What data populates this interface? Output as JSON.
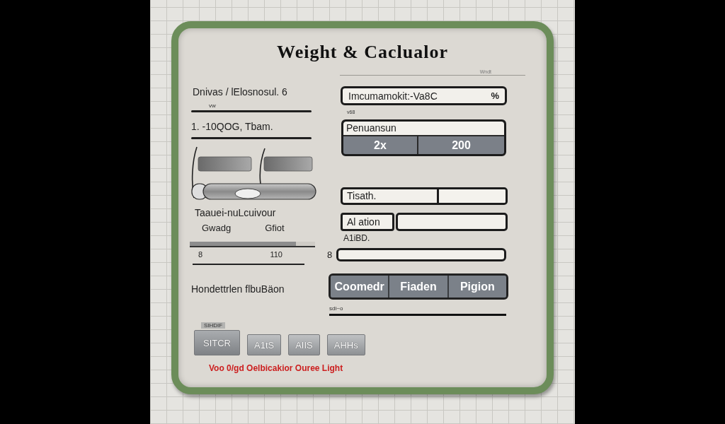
{
  "window": {
    "title": "Weight & Caclualor",
    "rule_caption": "Wndt"
  },
  "left_column": {
    "lines": [
      {
        "text": "Dnivas / lElosnosul. 6",
        "note": "vw"
      },
      {
        "text": "1. -10QOG, Tbam."
      }
    ],
    "slider": {
      "label": "Taauei-nuLcuivour",
      "captions": [
        "Gwadg",
        "Gfiot"
      ],
      "level": 0.85,
      "scale": [
        "8",
        "110"
      ]
    },
    "section_label": "Hondettrlen flbuBäon"
  },
  "right_column": {
    "items": [
      {
        "kind": "input",
        "value": "Imcumamokit:-Va8C",
        "unit": "%"
      },
      {
        "kind": "hint",
        "text": "v68"
      },
      {
        "kind": "stepper",
        "value": "Penuansun",
        "options": [
          "2x",
          "200"
        ]
      },
      {
        "kind": "split",
        "label": "Tisath."
      },
      {
        "kind": "labeled",
        "label": "Al ation"
      },
      {
        "kind": "note",
        "text": "A1iBD."
      },
      {
        "kind": "prefixed",
        "label": "8"
      },
      {
        "kind": "segmented",
        "options": [
          "Coomedr",
          "Fiaden",
          "Pigion"
        ]
      },
      {
        "kind": "rule",
        "caption": "sdi~o"
      }
    ]
  },
  "keypad": {
    "caption": "SIHDIF",
    "keys": [
      {
        "label": "SITCR",
        "selected": true
      },
      {
        "label": "A1tS",
        "selected": false
      },
      {
        "label": "AIIS",
        "selected": false
      },
      {
        "label": "AHHs",
        "selected": false
      }
    ]
  },
  "warning": "Voo 0/gd Oelbicakior Ouree Light"
}
